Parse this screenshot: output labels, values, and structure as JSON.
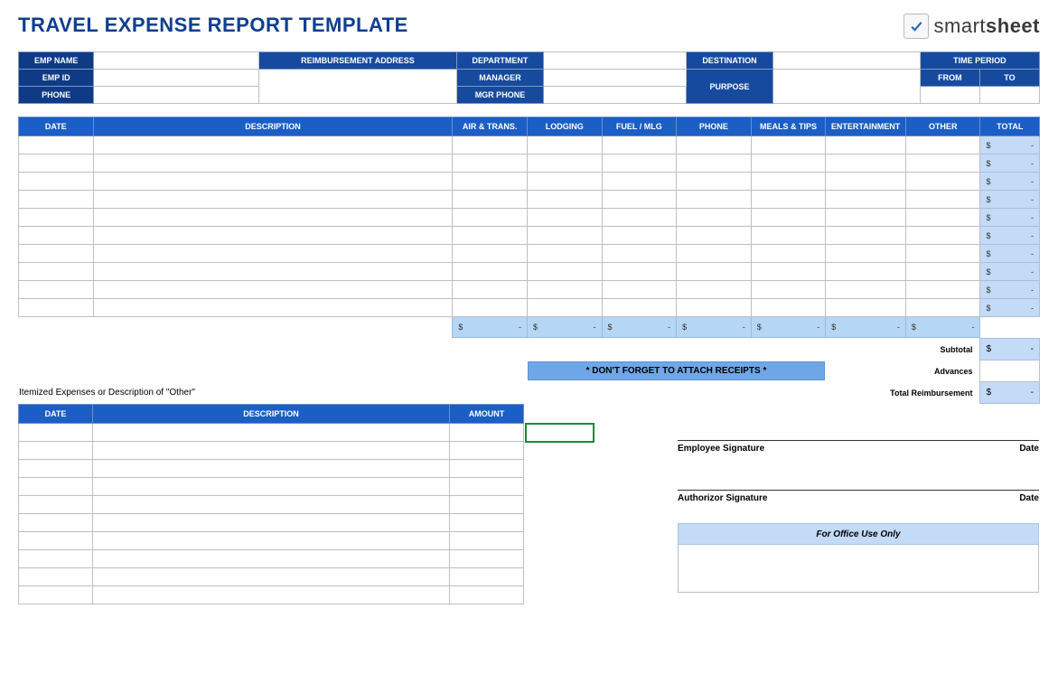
{
  "title": "TRAVEL EXPENSE REPORT TEMPLATE",
  "logo": {
    "brand_prefix": "smart",
    "brand_suffix": "sheet"
  },
  "info": {
    "emp_name_label": "EMP NAME",
    "emp_id_label": "EMP ID",
    "phone_label": "PHONE",
    "reimb_addr_label": "REIMBURSEMENT ADDRESS",
    "department_label": "DEPARTMENT",
    "manager_label": "MANAGER",
    "mgr_phone_label": "MGR PHONE",
    "destination_label": "DESTINATION",
    "purpose_label": "PURPOSE",
    "time_period_label": "TIME PERIOD",
    "from_label": "FROM",
    "to_label": "TO",
    "emp_name": "",
    "emp_id": "",
    "phone": "",
    "reimb_addr": "",
    "department": "",
    "manager": "",
    "mgr_phone": "",
    "destination": "",
    "purpose": "",
    "from": "",
    "to": ""
  },
  "grid": {
    "headers": {
      "date": "DATE",
      "description": "DESCRIPTION",
      "air": "AIR & TRANS.",
      "lodging": "LODGING",
      "fuel": "FUEL / MLG",
      "phone": "PHONE",
      "meals": "MEALS & TIPS",
      "ent": "ENTERTAINMENT",
      "other": "OTHER",
      "total": "TOTAL"
    },
    "row_count": 10,
    "currency": "$",
    "dash": "-"
  },
  "receipt_note": "* DON'T FORGET TO ATTACH RECEIPTS *",
  "summary": {
    "subtotal_label": "Subtotal",
    "advances_label": "Advances",
    "total_reimb_label": "Total Reimbursement"
  },
  "itemized": {
    "title": "Itemized Expenses or Description of \"Other\"",
    "headers": {
      "date": "DATE",
      "description": "DESCRIPTION",
      "amount": "AMOUNT"
    },
    "row_count": 10
  },
  "signatures": {
    "employee": "Employee Signature",
    "authorizor": "Authorizor Signature",
    "date": "Date"
  },
  "office": {
    "header": "For Office Use Only"
  }
}
